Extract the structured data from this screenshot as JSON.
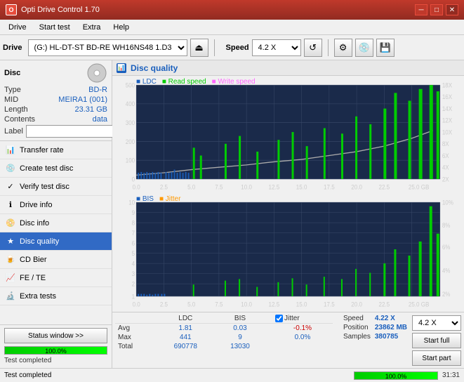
{
  "app": {
    "title": "Opti Drive Control 1.70",
    "icon": "O"
  },
  "titlebar": {
    "minimize": "─",
    "maximize": "□",
    "close": "✕"
  },
  "menubar": {
    "items": [
      "Drive",
      "Start test",
      "Extra",
      "Help"
    ]
  },
  "toolbar": {
    "drive_label": "Drive",
    "drive_value": "(G:)  HL-DT-ST BD-RE  WH16NS48 1.D3",
    "speed_label": "Speed",
    "speed_value": "4.2 X"
  },
  "disc": {
    "title": "Disc",
    "fields": [
      {
        "key": "Type",
        "value": "BD-R"
      },
      {
        "key": "MID",
        "value": "MEIRA1 (001)"
      },
      {
        "key": "Length",
        "value": "23.31 GB"
      },
      {
        "key": "Contents",
        "value": "data"
      }
    ],
    "label_placeholder": ""
  },
  "nav": {
    "items": [
      {
        "id": "transfer-rate",
        "label": "Transfer rate",
        "icon": "📊"
      },
      {
        "id": "create-test-disc",
        "label": "Create test disc",
        "icon": "💿"
      },
      {
        "id": "verify-test-disc",
        "label": "Verify test disc",
        "icon": "✓"
      },
      {
        "id": "drive-info",
        "label": "Drive info",
        "icon": "ℹ"
      },
      {
        "id": "disc-info",
        "label": "Disc info",
        "icon": "📀"
      },
      {
        "id": "disc-quality",
        "label": "Disc quality",
        "icon": "★",
        "active": true
      },
      {
        "id": "cd-bier",
        "label": "CD Bier",
        "icon": "🍺"
      },
      {
        "id": "fe-te",
        "label": "FE / TE",
        "icon": "📈"
      },
      {
        "id": "extra-tests",
        "label": "Extra tests",
        "icon": "🔬"
      }
    ]
  },
  "status": {
    "btn_label": "Status window >>",
    "progress": 100,
    "progress_text": "100.0%",
    "status_text": "Test completed",
    "time": "31:31"
  },
  "chart": {
    "title": "Disc quality",
    "legend": {
      "ldc": "LDC",
      "read_speed": "Read speed",
      "write_speed": "Write speed"
    },
    "legend2": {
      "bis": "BIS",
      "jitter": "Jitter"
    },
    "top": {
      "y_max": 500,
      "y_labels": [
        "500",
        "400",
        "300",
        "200",
        "100",
        "0"
      ],
      "x_labels": [
        "0.0",
        "2.5",
        "5.0",
        "7.5",
        "10.0",
        "12.5",
        "15.0",
        "17.5",
        "20.0",
        "22.5",
        "25.0 GB"
      ],
      "right_labels": [
        "18X",
        "16X",
        "14X",
        "12X",
        "10X",
        "8X",
        "6X",
        "4X",
        "2X"
      ]
    },
    "bottom": {
      "y_max": 10,
      "y_labels": [
        "10",
        "9",
        "8",
        "7",
        "6",
        "5",
        "4",
        "3",
        "2",
        "1"
      ],
      "x_labels": [
        "0.0",
        "2.5",
        "5.0",
        "7.5",
        "10.0",
        "12.5",
        "15.0",
        "17.5",
        "20.0",
        "22.5",
        "25.0 GB"
      ],
      "right_labels": [
        "10%",
        "8%",
        "6%",
        "4%",
        "2%"
      ]
    }
  },
  "stats": {
    "columns": [
      "",
      "LDC",
      "BIS",
      "",
      "Jitter",
      "Speed"
    ],
    "rows": [
      {
        "label": "Avg",
        "ldc": "1.81",
        "bis": "0.03",
        "jitter": "-0.1%",
        "speed": "4.22 X"
      },
      {
        "label": "Max",
        "ldc": "441",
        "bis": "9",
        "jitter": "0.0%",
        "position": "23862 MB"
      },
      {
        "label": "Total",
        "ldc": "690778",
        "bis": "13030",
        "jitter": "",
        "samples": "380785"
      }
    ],
    "jitter_label": "Jitter",
    "speed_label": "Speed",
    "speed_value": "4.22 X",
    "position_label": "Position",
    "position_value": "23862 MB",
    "samples_label": "Samples",
    "samples_value": "380785",
    "speed_select": "4.2 X",
    "btn_start_full": "Start full",
    "btn_start_part": "Start part"
  }
}
